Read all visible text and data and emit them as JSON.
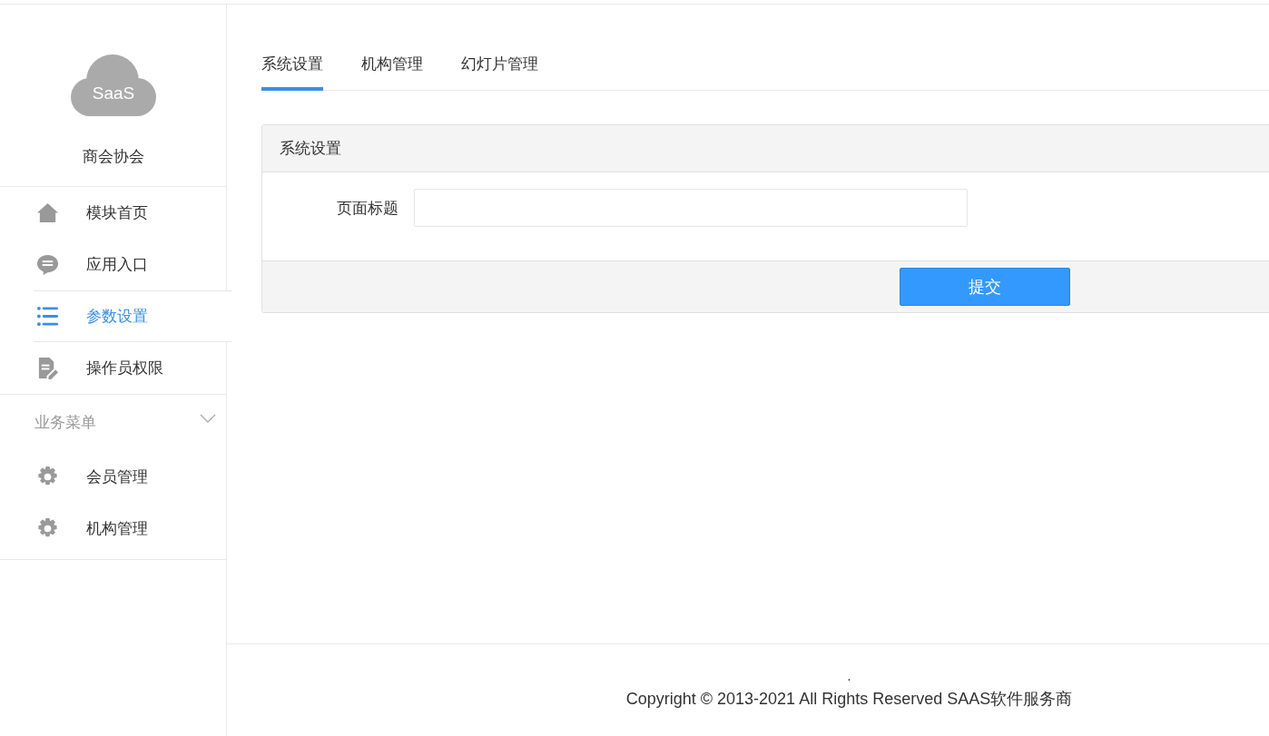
{
  "sidebar": {
    "logo_text": "SaaS",
    "org_name": "商会协会",
    "items": [
      {
        "label": "模块首页",
        "kind": "home",
        "selected": false
      },
      {
        "label": "应用入口",
        "kind": "chat",
        "selected": false
      },
      {
        "label": "参数设置",
        "kind": "list",
        "selected": true
      },
      {
        "label": "操作员权限",
        "kind": "doc",
        "selected": false
      }
    ],
    "groups": [
      {
        "label": "业务菜单",
        "expanded": true,
        "children": [
          {
            "label": "会员管理",
            "kind": "gear",
            "selected": false
          },
          {
            "label": "机构管理",
            "kind": "gear",
            "selected": false
          }
        ]
      }
    ]
  },
  "tabs": [
    {
      "label": "系统设置",
      "selected": true
    },
    {
      "label": "机构管理",
      "selected": false
    },
    {
      "label": "幻灯片管理",
      "selected": false
    }
  ],
  "panel": {
    "title": "系统设置",
    "fields": [
      {
        "label": "页面标题"
      }
    ],
    "submit": "提交"
  },
  "footer": {
    "mark": ".",
    "copyright": "Copyright © 2013-2021 All Rights Reserved SAAS软件服务商"
  }
}
